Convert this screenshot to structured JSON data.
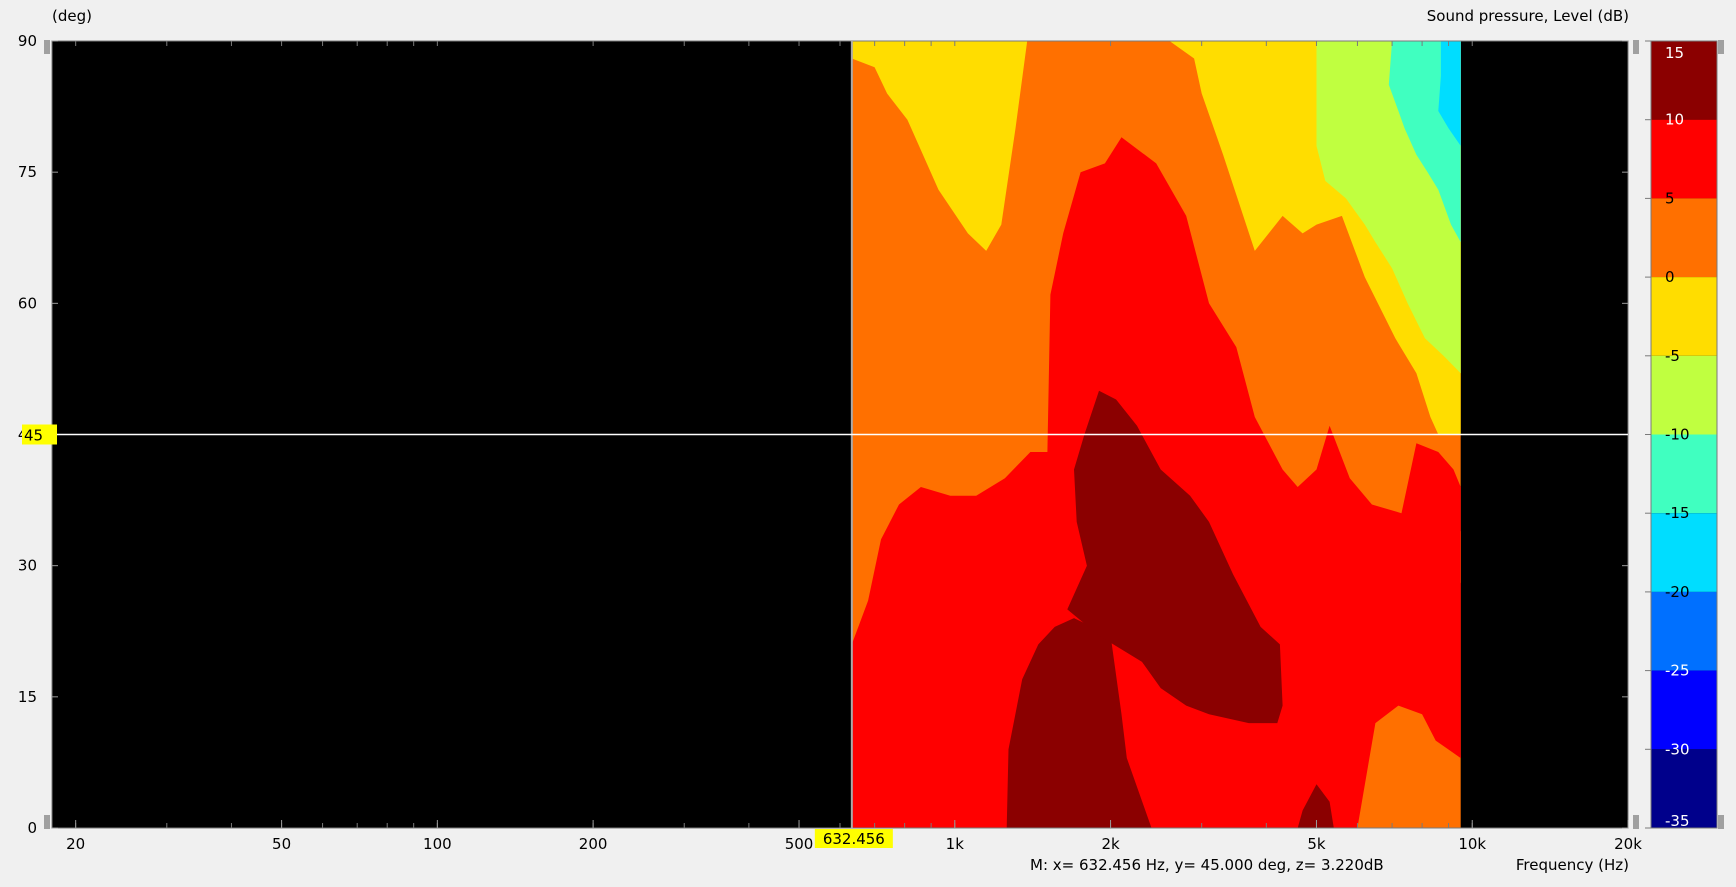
{
  "chart_data": {
    "type": "heatmap",
    "title": "Sound pressure, Level  (dB)",
    "ylabel": "(deg)",
    "xlabel": "Frequency  (Hz)",
    "x_scale": "log",
    "xlim": [
      18,
      20000
    ],
    "ylim": [
      0,
      90
    ],
    "x_ticks": [
      {
        "value": 20,
        "label": "20"
      },
      {
        "value": 50,
        "label": "50"
      },
      {
        "value": 100,
        "label": "100"
      },
      {
        "value": 200,
        "label": "200"
      },
      {
        "value": 500,
        "label": "500"
      },
      {
        "value": 1000,
        "label": "1k"
      },
      {
        "value": 2000,
        "label": "2k"
      },
      {
        "value": 5000,
        "label": "5k"
      },
      {
        "value": 10000,
        "label": "10k"
      },
      {
        "value": 20000,
        "label": "20k"
      }
    ],
    "y_ticks": [
      {
        "value": 0,
        "label": "0"
      },
      {
        "value": 15,
        "label": "15"
      },
      {
        "value": 30,
        "label": "30"
      },
      {
        "value": 45,
        "label": "45"
      },
      {
        "value": 60,
        "label": "60"
      },
      {
        "value": 75,
        "label": "75"
      },
      {
        "value": 90,
        "label": "90"
      }
    ],
    "data_xrange": [
      632.456,
      9500
    ],
    "levels": [
      {
        "from": 10,
        "to": 15,
        "color": "#8b0000"
      },
      {
        "from": 5,
        "to": 10,
        "color": "#ff0000"
      },
      {
        "from": 0,
        "to": 5,
        "color": "#ff7000"
      },
      {
        "from": -5,
        "to": 0,
        "color": "#ffdd00"
      },
      {
        "from": -10,
        "to": -5,
        "color": "#c0ff40"
      },
      {
        "from": -15,
        "to": -10,
        "color": "#40ffc0"
      },
      {
        "from": -20,
        "to": -15,
        "color": "#00ddff"
      },
      {
        "from": -25,
        "to": -20,
        "color": "#0070ff"
      },
      {
        "from": -30,
        "to": -25,
        "color": "#0000ff"
      },
      {
        "from": -35,
        "to": -30,
        "color": "#00008b"
      }
    ],
    "colorbar_labels": [
      15,
      10,
      5,
      0,
      -5,
      -10,
      -15,
      -20,
      -25,
      -30,
      -35
    ],
    "regions": [
      {
        "level": "orange",
        "color": "#ff7000",
        "points": [
          [
            632.456,
            0
          ],
          [
            9500,
            0
          ],
          [
            9500,
            90
          ],
          [
            632.456,
            90
          ]
        ]
      },
      {
        "level": "yellow",
        "color": "#ffdd00",
        "points": [
          [
            632.456,
            90
          ],
          [
            1380,
            90
          ],
          [
            1310,
            80
          ],
          [
            1230,
            69
          ],
          [
            1150,
            66
          ],
          [
            1060,
            68
          ],
          [
            930,
            73
          ],
          [
            810,
            81
          ],
          [
            740,
            84
          ],
          [
            700,
            87
          ],
          [
            632.456,
            88
          ]
        ]
      },
      {
        "level": "yellow",
        "color": "#ffdd00",
        "points": [
          [
            2600,
            90
          ],
          [
            9500,
            90
          ],
          [
            9500,
            45
          ],
          [
            8600,
            45
          ],
          [
            8300,
            47
          ],
          [
            7800,
            52
          ],
          [
            7100,
            56
          ],
          [
            6200,
            63
          ],
          [
            5600,
            70
          ],
          [
            5000,
            69
          ],
          [
            4700,
            68
          ],
          [
            4300,
            70
          ],
          [
            3800,
            66
          ],
          [
            3300,
            77
          ],
          [
            3000,
            84
          ],
          [
            2900,
            88
          ]
        ]
      },
      {
        "level": "yellow",
        "color": "#ffdd00",
        "points": [
          [
            9500,
            28
          ],
          [
            9300,
            30
          ],
          [
            9400,
            33
          ],
          [
            9500,
            34
          ]
        ]
      },
      {
        "level": "yellow-green",
        "color": "#c0ff40",
        "points": [
          [
            5000,
            90
          ],
          [
            9500,
            90
          ],
          [
            9500,
            52
          ],
          [
            8800,
            54
          ],
          [
            8100,
            56
          ],
          [
            7500,
            60
          ],
          [
            7000,
            64
          ],
          [
            6500,
            67
          ],
          [
            6200,
            69
          ],
          [
            5700,
            72
          ],
          [
            5200,
            74
          ],
          [
            5000,
            78
          ]
        ]
      },
      {
        "level": "teal",
        "color": "#40ffc0",
        "points": [
          [
            7000,
            90
          ],
          [
            9500,
            90
          ],
          [
            9500,
            67
          ],
          [
            9100,
            69
          ],
          [
            8600,
            73
          ],
          [
            8200,
            75
          ],
          [
            7800,
            77
          ],
          [
            7400,
            80
          ],
          [
            7200,
            82
          ],
          [
            6900,
            85
          ]
        ]
      },
      {
        "level": "cyan",
        "color": "#00ddff",
        "points": [
          [
            8700,
            90
          ],
          [
            9500,
            90
          ],
          [
            9500,
            78
          ],
          [
            9000,
            80
          ],
          [
            8600,
            82
          ],
          [
            8700,
            86
          ]
        ]
      },
      {
        "level": "red",
        "color": "#ff0000",
        "points": [
          [
            632.456,
            0
          ],
          [
            5800,
            0
          ],
          [
            5200,
            4
          ],
          [
            4500,
            2
          ],
          [
            3300,
            5
          ],
          [
            3000,
            12
          ],
          [
            2600,
            13
          ],
          [
            2200,
            13
          ],
          [
            2100,
            15
          ],
          [
            2200,
            18
          ],
          [
            2000,
            22
          ],
          [
            1700,
            24
          ],
          [
            1560,
            23
          ],
          [
            1450,
            21
          ],
          [
            1350,
            17
          ],
          [
            1270,
            9
          ],
          [
            1260,
            0
          ],
          [
            6000,
            0
          ],
          [
            6500,
            12
          ],
          [
            7200,
            14
          ],
          [
            8000,
            13
          ],
          [
            8500,
            10
          ],
          [
            9500,
            8
          ],
          [
            9500,
            39
          ],
          [
            9200,
            41
          ],
          [
            8600,
            43
          ],
          [
            7800,
            44
          ],
          [
            7300,
            36
          ],
          [
            6400,
            37
          ],
          [
            5800,
            40
          ],
          [
            5300,
            46
          ],
          [
            5000,
            41
          ],
          [
            4600,
            39
          ],
          [
            4300,
            41
          ],
          [
            3800,
            47
          ],
          [
            3500,
            55
          ],
          [
            3100,
            60
          ],
          [
            2800,
            70
          ],
          [
            2450,
            76
          ],
          [
            2100,
            79
          ],
          [
            1950,
            76
          ],
          [
            1750,
            75
          ],
          [
            1620,
            68
          ],
          [
            1530,
            61
          ],
          [
            1510,
            43
          ],
          [
            1400,
            43
          ],
          [
            1250,
            40
          ],
          [
            1100,
            38
          ],
          [
            980,
            38
          ],
          [
            860,
            39
          ],
          [
            780,
            37
          ],
          [
            720,
            33
          ],
          [
            680,
            26
          ],
          [
            632.456,
            21
          ]
        ]
      },
      {
        "level": "dark red",
        "color": "#8b0000",
        "points": [
          [
            1260,
            0
          ],
          [
            2400,
            0
          ],
          [
            2150,
            8
          ],
          [
            2100,
            13
          ],
          [
            2000,
            22
          ],
          [
            1700,
            24
          ],
          [
            1560,
            23
          ],
          [
            1450,
            21
          ],
          [
            1350,
            17
          ],
          [
            1270,
            9
          ]
        ]
      },
      {
        "level": "dark red",
        "color": "#8b0000",
        "points": [
          [
            1650,
            25
          ],
          [
            1800,
            30
          ],
          [
            1720,
            35
          ],
          [
            1700,
            41
          ],
          [
            1780,
            45
          ],
          [
            1900,
            50
          ],
          [
            2050,
            49
          ],
          [
            2250,
            46
          ],
          [
            2500,
            41
          ],
          [
            2850,
            38
          ],
          [
            3100,
            35
          ],
          [
            3450,
            29
          ],
          [
            3900,
            23
          ],
          [
            4250,
            21
          ],
          [
            4300,
            14
          ],
          [
            4200,
            12
          ],
          [
            3700,
            12
          ],
          [
            3100,
            13
          ],
          [
            2800,
            14
          ],
          [
            2500,
            16
          ],
          [
            2300,
            19
          ],
          [
            1900,
            22
          ]
        ]
      },
      {
        "level": "dark red",
        "color": "#8b0000",
        "points": [
          [
            4600,
            0
          ],
          [
            5400,
            0
          ],
          [
            5300,
            3
          ],
          [
            5000,
            5
          ],
          [
            4700,
            2
          ]
        ]
      },
      {
        "level": "red",
        "color": "#ff0000",
        "points": [
          [
            3000,
            0
          ],
          [
            3350,
            0
          ],
          [
            3250,
            4
          ],
          [
            3100,
            5
          ]
        ]
      },
      {
        "level": "red",
        "color": "#ff0000",
        "points": [
          [
            9000,
            9
          ],
          [
            9500,
            8
          ],
          [
            9400,
            13
          ],
          [
            9200,
            12
          ]
        ]
      }
    ]
  },
  "marker": {
    "x": 632.456,
    "y": 45,
    "x_label": "632.456",
    "y_label": "45"
  },
  "status_text": "M:  x= 632.456 Hz,  y= 45.000 deg, z= 3.220dB",
  "colors": {
    "background": "#f0f0f0",
    "plot_bg": "#000000",
    "marker_label_bg": "#ffff00"
  }
}
